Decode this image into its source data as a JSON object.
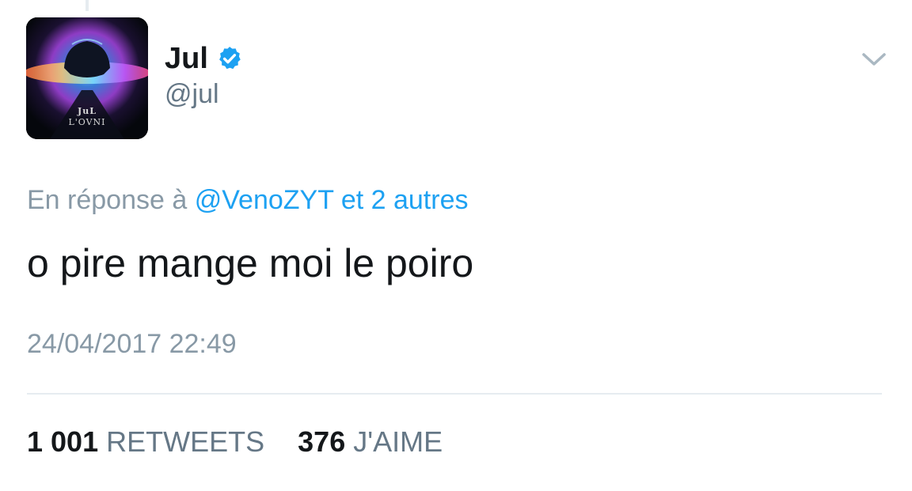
{
  "author": {
    "display_name": "Jul",
    "handle": "@jul",
    "verified_icon": "verified-badge-icon",
    "avatar_text": {
      "artist": "JuL",
      "album": "L'OVNI"
    }
  },
  "menu_icon": "chevron-down-icon",
  "reply": {
    "prefix": "En réponse à",
    "mention": "@VenoZYT",
    "suffix": "et 2 autres"
  },
  "tweet": {
    "text": "o pire mange moi le poiro",
    "timestamp": "24/04/2017 22:49"
  },
  "stats": {
    "retweets_count": "1 001",
    "retweets_label": "RETWEETS",
    "likes_count": "376",
    "likes_label": "J'AIME"
  },
  "colors": {
    "link": "#1da1f2",
    "secondary_text": "#8899a6",
    "primary_text": "#14171a",
    "verified": "#1da1f2"
  }
}
